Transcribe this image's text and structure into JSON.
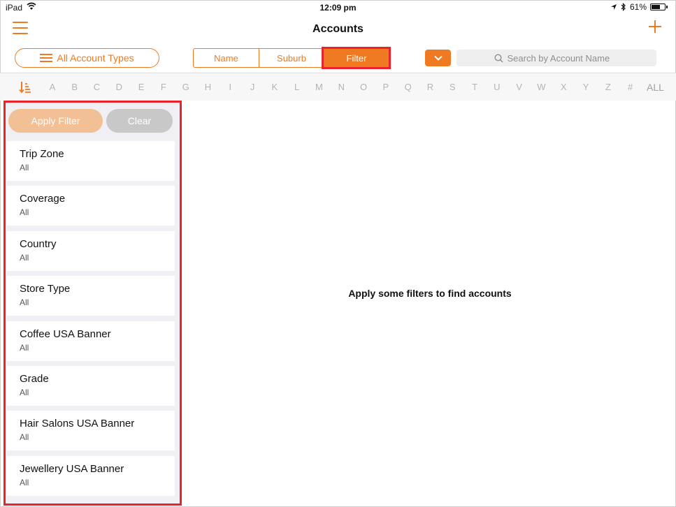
{
  "status_bar": {
    "carrier": "iPad",
    "time": "12:09 pm",
    "battery": "61%",
    "battery_level": 0.61
  },
  "nav": {
    "title": "Accounts",
    "menu_icon": "hamburger-icon",
    "add_icon": "plus-icon"
  },
  "toolbar": {
    "account_types_label": "All Account Types",
    "segments": [
      "Name",
      "Suburb",
      "Filter"
    ],
    "active_segment": "Filter",
    "dropdown_icon": "chevron-down-icon",
    "search_placeholder": "Search by Account Name",
    "search_value": ""
  },
  "alphabet": {
    "letters": [
      "A",
      "B",
      "C",
      "D",
      "E",
      "F",
      "G",
      "H",
      "I",
      "J",
      "K",
      "L",
      "M",
      "N",
      "O",
      "P",
      "Q",
      "R",
      "S",
      "T",
      "U",
      "V",
      "W",
      "X",
      "Y",
      "Z",
      "#"
    ],
    "all_label": "ALL"
  },
  "filter_panel": {
    "apply_label": "Apply Filter",
    "clear_label": "Clear",
    "items": [
      {
        "name": "Trip Zone",
        "value": "All"
      },
      {
        "name": "Coverage",
        "value": "All"
      },
      {
        "name": "Country",
        "value": "All"
      },
      {
        "name": "Store Type",
        "value": "All"
      },
      {
        "name": "Coffee USA Banner",
        "value": "All"
      },
      {
        "name": "Grade",
        "value": "All"
      },
      {
        "name": "Hair Salons USA Banner",
        "value": "All"
      },
      {
        "name": "Jewellery USA Banner",
        "value": "All"
      }
    ]
  },
  "main": {
    "empty_message": "Apply some filters to find accounts"
  },
  "colors": {
    "accent": "#f07a22",
    "highlight": "#e8232c",
    "apply_disabled": "#f3bf95",
    "clear_bg": "#c8c8c8"
  }
}
